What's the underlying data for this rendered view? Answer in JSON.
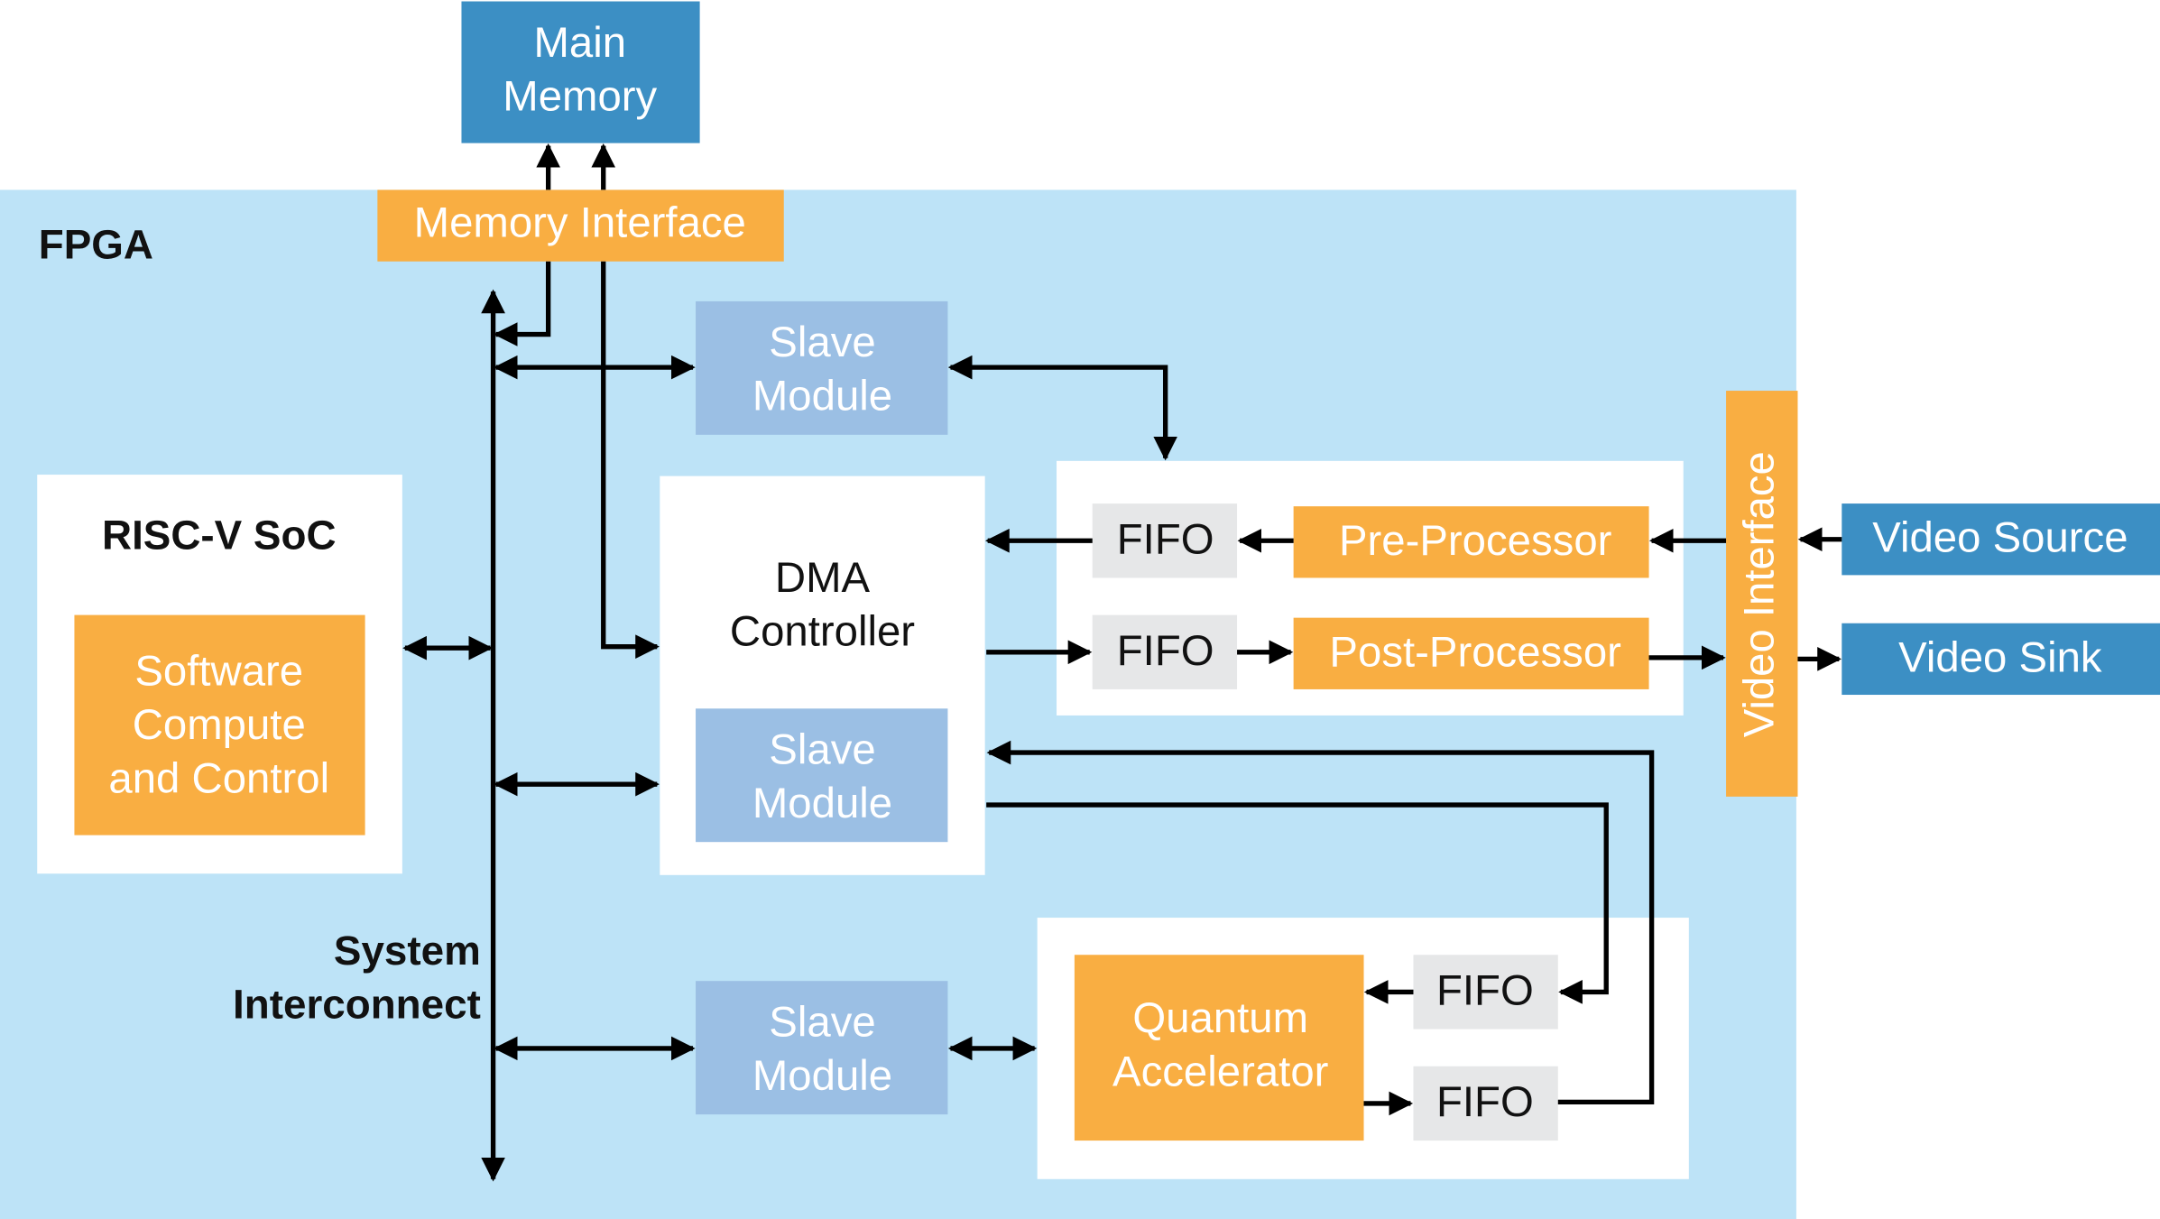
{
  "colors": {
    "fpga_region": "#bde3f7",
    "external_block": "#3c8fc4",
    "orange_block": "#f9ae42",
    "slave_module": "#9bbfe4",
    "fifo": "#e6e7e8",
    "panel": "#ffffff"
  },
  "main_memory": {
    "line1": "Main",
    "line2": "Memory"
  },
  "fpga_label": "FPGA",
  "memory_interface": "Memory Interface",
  "risc_soc": {
    "title": "RISC-V SoC",
    "inner": [
      "Software",
      "Compute",
      "and Control"
    ]
  },
  "slave_modules": [
    {
      "line1": "Slave",
      "line2": "Module"
    },
    {
      "line1": "Slave",
      "line2": "Module"
    },
    {
      "line1": "Slave",
      "line2": "Module"
    }
  ],
  "dma": {
    "line1": "DMA",
    "line2": "Controller"
  },
  "fifos": [
    "FIFO",
    "FIFO",
    "FIFO",
    "FIFO"
  ],
  "pre_processor": "Pre-Processor",
  "post_processor": "Post-Processor",
  "video_interface": "Video Interface",
  "video_source": "Video Source",
  "video_sink": "Video Sink",
  "quantum": {
    "line1": "Quantum",
    "line2": "Accelerator"
  },
  "system_interconnect": {
    "line1": "System",
    "line2": "Interconnect"
  }
}
